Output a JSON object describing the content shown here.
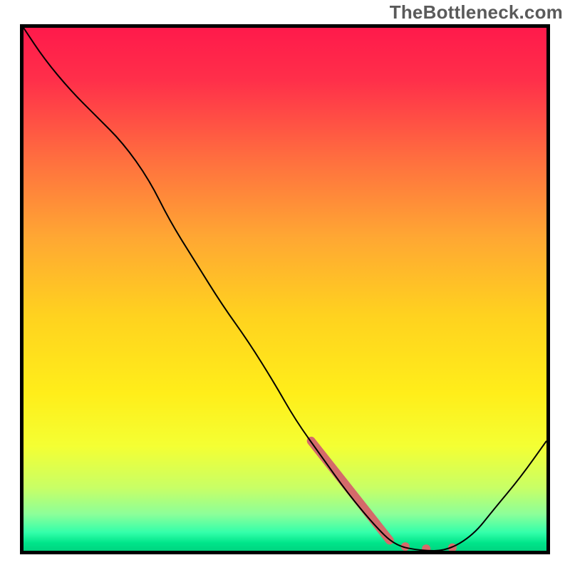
{
  "watermark": "TheBottleneck.com",
  "chart_data": {
    "type": "line",
    "title": "",
    "xlabel": "",
    "ylabel": "",
    "xlim": [
      0,
      100
    ],
    "ylim": [
      0,
      100
    ],
    "grid": false,
    "legend": false,
    "series": [
      {
        "name": "bottleneck-curve",
        "x": [
          0,
          4,
          9,
          14,
          19,
          24,
          28,
          33,
          38,
          43,
          48,
          52,
          57,
          62,
          67,
          71,
          76,
          81,
          86,
          90,
          95,
          100
        ],
        "y": [
          100,
          94,
          88,
          83,
          78,
          71,
          63,
          55,
          47,
          40,
          32,
          25,
          18,
          11,
          5,
          1,
          0,
          0,
          3,
          8,
          14,
          21
        ],
        "color": "#000000",
        "stroke_width": 2
      }
    ],
    "highlight_band": {
      "name": "optimal-band",
      "color": "#d46a6a",
      "segments": [
        {
          "type": "line",
          "x1": 55,
          "y1": 21,
          "x2": 70,
          "y2": 2,
          "width": 12
        },
        {
          "type": "dot",
          "x": 73,
          "y": 0.8,
          "r": 6
        },
        {
          "type": "dot",
          "x": 77,
          "y": 0.4,
          "r": 6
        },
        {
          "type": "dot",
          "x": 82,
          "y": 0.6,
          "r": 6
        }
      ]
    },
    "background_gradient": {
      "stops": [
        {
          "offset": 0.0,
          "color": "#ff1a4b"
        },
        {
          "offset": 0.1,
          "color": "#ff2f4a"
        },
        {
          "offset": 0.25,
          "color": "#ff6e3f"
        },
        {
          "offset": 0.4,
          "color": "#ffa733"
        },
        {
          "offset": 0.55,
          "color": "#ffd21f"
        },
        {
          "offset": 0.7,
          "color": "#ffee1a"
        },
        {
          "offset": 0.8,
          "color": "#f4ff33"
        },
        {
          "offset": 0.88,
          "color": "#c8ff66"
        },
        {
          "offset": 0.93,
          "color": "#8cff99"
        },
        {
          "offset": 0.965,
          "color": "#33ffaa"
        },
        {
          "offset": 0.985,
          "color": "#00e58a"
        },
        {
          "offset": 1.0,
          "color": "#00d480"
        }
      ]
    }
  }
}
